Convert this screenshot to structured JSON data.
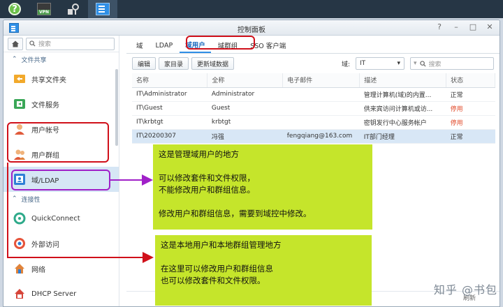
{
  "window": {
    "title": "控制面板"
  },
  "sidebar": {
    "search_placeholder": "搜索",
    "sections": [
      {
        "label": "文件共享"
      },
      {
        "label": "连接性"
      }
    ],
    "items": [
      {
        "label": "共享文件夹"
      },
      {
        "label": "文件服务"
      },
      {
        "label": "用户帐号"
      },
      {
        "label": "用户群组"
      },
      {
        "label": "域/LDAP"
      },
      {
        "label": "QuickConnect"
      },
      {
        "label": "外部访问"
      },
      {
        "label": "网络"
      },
      {
        "label": "DHCP Server"
      }
    ]
  },
  "tabs": [
    "域",
    "LDAP",
    "域用户",
    "域群组",
    "SSO 客户端"
  ],
  "toolbar": {
    "edit": "编辑",
    "home_dir": "家目录",
    "update": "更新域数据",
    "domain_label": "域:",
    "domain_value": "IT",
    "search_placeholder": "搜索"
  },
  "table": {
    "headers": [
      "名称",
      "全称",
      "电子邮件",
      "描述",
      "状态"
    ],
    "rows": [
      [
        "IT\\Administrator",
        "Administrator",
        "",
        "管理计算机(域)的内置...",
        "正常"
      ],
      [
        "IT\\Guest",
        "Guest",
        "",
        "供来宾访问计算机或访...",
        "停用"
      ],
      [
        "IT\\krbtgt",
        "krbtgt",
        "",
        "密钥发行中心服务帐户",
        "停用"
      ],
      [
        "IT\\20200307",
        "冯强",
        "fengqiang@163.com",
        "IT部门经理",
        "正常"
      ]
    ],
    "refresh": "刷新"
  },
  "notes": {
    "note1": "这是管理域用户的地方\n\n可以修改套件和文件权限，\n不能修改用户和群组信息。\n\n修改用户和群组信息，需要到域控中修改。",
    "note2": "这是本地用户和本地群组管理地方\n\n在这里可以修改用户和群组信息\n也可以修改套件和文件权限。"
  },
  "watermark": "知乎 @书包",
  "colors": {
    "annotation_red": "#d0101a",
    "annotation_purple": "#a020c8",
    "note_bg": "#c5e52b",
    "status_disabled": "#e04a2a"
  }
}
